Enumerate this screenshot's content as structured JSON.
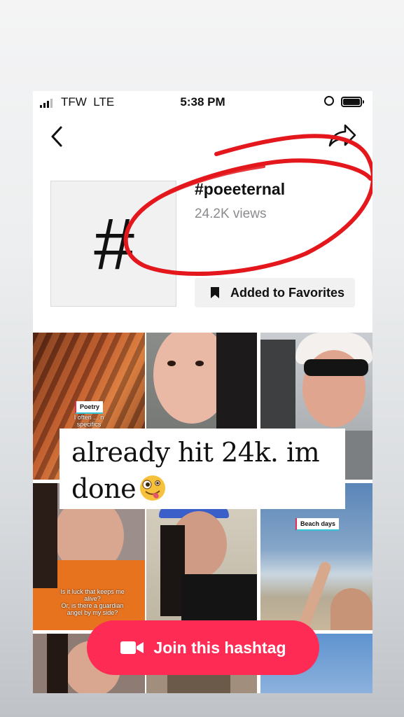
{
  "status_bar": {
    "carrier": "TFW",
    "network": "LTE",
    "time": "5:38 PM"
  },
  "hashtag": {
    "symbol": "#",
    "name": "#poeeternal",
    "views": "24.2K views"
  },
  "favorites_button": {
    "label": "Added to Favorites"
  },
  "videos": [
    {
      "chip": "Poetry",
      "caption": "I often ... n\nspecifics"
    },
    {
      "chip": "",
      "caption": ""
    },
    {
      "chip": "",
      "caption": ""
    },
    {
      "chip": "",
      "caption": "Is it luck that keeps me\nalive?\nOr, is there a guardian\nangel by my side?"
    },
    {
      "chip": "",
      "caption": ""
    },
    {
      "chip": "Beach days",
      "caption": ""
    }
  ],
  "story_overlay": {
    "text": "already hit 24k. im done"
  },
  "join_button": {
    "label": "Join this hashtag"
  },
  "colors": {
    "accent": "#fe2c55",
    "annotation_red": "#e3171c"
  },
  "icons": [
    "back-chevron-icon",
    "share-icon",
    "bookmark-icon",
    "video-camera-icon",
    "zany-face-emoji"
  ]
}
